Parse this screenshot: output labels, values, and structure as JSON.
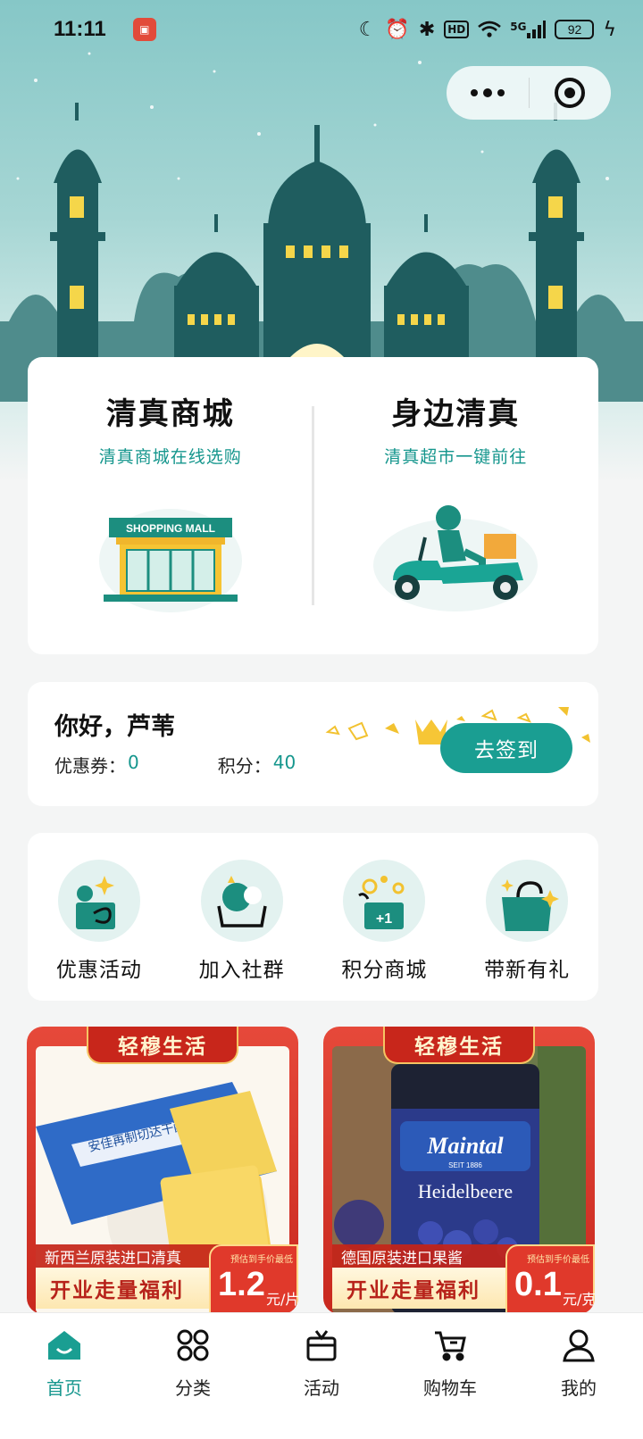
{
  "status_bar": {
    "time": "11:11",
    "network": "5G",
    "hd": "HD",
    "battery": "92"
  },
  "capsule": {
    "more_icon": "more-dots-icon",
    "close_icon": "target-close-icon"
  },
  "entries": [
    {
      "title": "清真商城",
      "subtitle": "清真商城在线选购",
      "sign_text": "SHOPPING MALL"
    },
    {
      "title": "身边清真",
      "subtitle": "清真超市一键前往"
    }
  ],
  "user": {
    "greeting": "你好，芦苇",
    "coupon_label": "优惠券：",
    "coupon_value": "0",
    "points_label": "积分：",
    "points_value": "40",
    "signin_button": "去签到"
  },
  "shortcuts": [
    {
      "label": "优惠活动",
      "icon": "discount-icon"
    },
    {
      "label": "加入社群",
      "icon": "community-icon"
    },
    {
      "label": "积分商城",
      "icon": "points-mall-icon",
      "badge": "+1"
    },
    {
      "label": "带新有礼",
      "icon": "gift-bag-icon"
    }
  ],
  "products": [
    {
      "badge": "轻穆生活",
      "caption": "新西兰原装进口清真",
      "promo": "开业走量福利",
      "price_label": "预估到手价最低",
      "price": "1.2",
      "unit": "元/片",
      "package_text": "安佳再制切达干酪"
    },
    {
      "badge": "轻穆生活",
      "caption": "德国原装进口果酱",
      "promo": "开业走量福利",
      "price_label": "预估到手价最低",
      "price": "0.1",
      "unit": "元/克",
      "brand": "Maintal",
      "flavor": "Heidelbeere",
      "since": "SEIT 1886"
    }
  ],
  "tabs": [
    {
      "label": "首页",
      "icon": "home-icon",
      "active": true
    },
    {
      "label": "分类",
      "icon": "category-icon"
    },
    {
      "label": "活动",
      "icon": "activity-icon"
    },
    {
      "label": "购物车",
      "icon": "cart-icon"
    },
    {
      "label": "我的",
      "icon": "profile-icon"
    }
  ],
  "colors": {
    "accent": "#15968d",
    "button": "#1a9e92",
    "promo_red": "#d23526",
    "text": "#111111"
  }
}
